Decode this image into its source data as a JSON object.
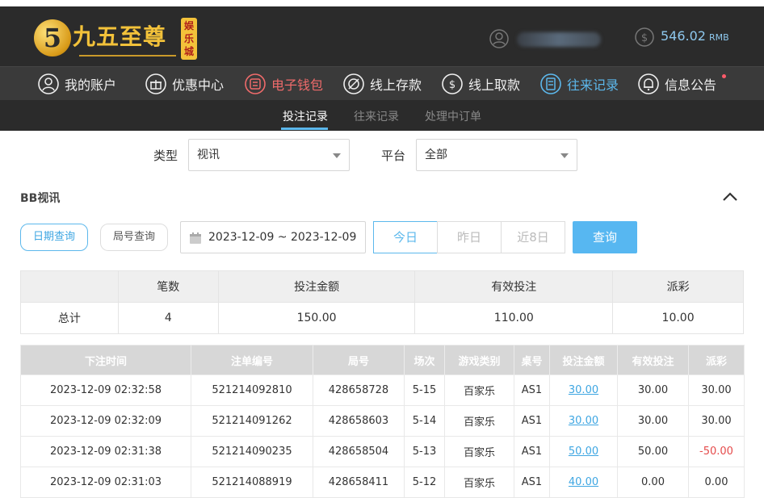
{
  "header": {
    "logo_glyph": "5",
    "logo_text": "九五至尊",
    "logo_tag": "娱乐城",
    "balance": "546.02",
    "currency": "RMB"
  },
  "nav": [
    {
      "label": "我的账户",
      "icon": "user-circle-icon",
      "state": "normal"
    },
    {
      "label": "优惠中心",
      "icon": "gift-icon",
      "state": "normal"
    },
    {
      "label": "电子钱包",
      "icon": "wallet-icon",
      "state": "red"
    },
    {
      "label": "线上存款",
      "icon": "deposit-icon",
      "state": "normal"
    },
    {
      "label": "线上取款",
      "icon": "withdraw-icon",
      "state": "normal"
    },
    {
      "label": "往来记录",
      "icon": "records-icon",
      "state": "active"
    },
    {
      "label": "信息公告",
      "icon": "bell-icon",
      "state": "normal"
    }
  ],
  "subtabs": [
    "投注记录",
    "往来记录",
    "处理中订单"
  ],
  "filters": {
    "type_label": "类型",
    "type_value": "视讯",
    "platform_label": "平台",
    "platform_value": "全部"
  },
  "section_title": "BB视讯",
  "query": {
    "date_query": "日期查询",
    "round_query": "局号查询",
    "date_range": "2023-12-09 ~ 2023-12-09",
    "today": "今日",
    "yesterday": "昨日",
    "last8": "近8日",
    "submit": "查询"
  },
  "summary": {
    "headers": [
      "",
      "笔数",
      "投注金额",
      "有效投注",
      "派彩"
    ],
    "row": [
      "总计",
      "4",
      "150.00",
      "110.00",
      "10.00"
    ]
  },
  "records": {
    "headers": [
      "下注时间",
      "注单编号",
      "局号",
      "场次",
      "游戏类别",
      "桌号",
      "投注金额",
      "有效投注",
      "派彩"
    ],
    "rows": [
      [
        "2023-12-09 02:32:58",
        "521214092810",
        "428658728",
        "5-15",
        "百家乐",
        "AS1",
        "30.00",
        "30.00",
        "30.00"
      ],
      [
        "2023-12-09 02:32:09",
        "521214091262",
        "428658603",
        "5-14",
        "百家乐",
        "AS1",
        "30.00",
        "30.00",
        "30.00"
      ],
      [
        "2023-12-09 02:31:38",
        "521214090235",
        "428658504",
        "5-13",
        "百家乐",
        "AS1",
        "50.00",
        "50.00",
        "-50.00"
      ],
      [
        "2023-12-09 02:31:03",
        "521214088919",
        "428658411",
        "5-12",
        "百家乐",
        "AS1",
        "40.00",
        "0.00",
        "0.00"
      ]
    ]
  },
  "colors": {
    "accent": "#5cb8ec",
    "negative": "#e54b4b",
    "header_bg": "#2b2b2b"
  }
}
